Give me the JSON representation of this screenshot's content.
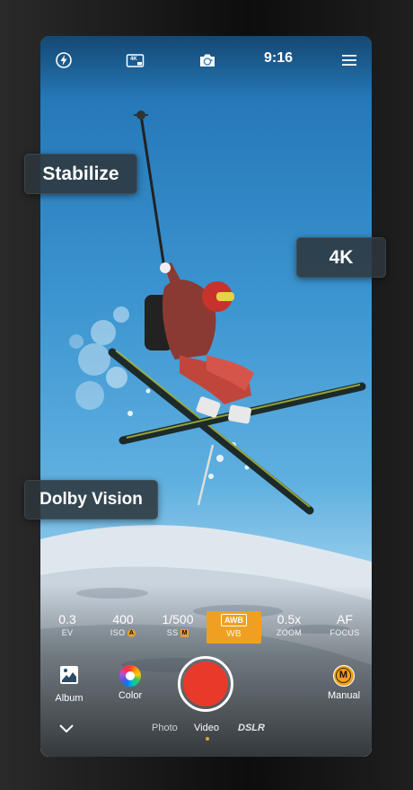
{
  "top_bar": {
    "flash_icon": "flash-auto-icon",
    "resolution_icon": "4k-icon",
    "resolution_icon_text": "4K",
    "flip_camera_icon": "camera-flip-icon",
    "time": "9:16",
    "menu_icon": "hamburger-menu-icon"
  },
  "params": [
    {
      "value": "0.3",
      "label": "EV"
    },
    {
      "value": "400",
      "label": "ISO",
      "badge": "A"
    },
    {
      "value": "1/500",
      "label": "SS",
      "badge": "M"
    },
    {
      "value": "AWB",
      "label": "WB",
      "selected": true
    },
    {
      "value": "0.5x",
      "label": "ZOOM"
    },
    {
      "value": "AF",
      "label": "FOCUS"
    }
  ],
  "controls": {
    "album_label": "Album",
    "color_label": "Color",
    "manual_label": "Manual",
    "manual_icon_text": "M"
  },
  "modes": {
    "photo": "Photo",
    "video": "Video",
    "dslr": "DSLR",
    "active": "Video"
  },
  "callouts": {
    "stabilize": "Stabilize",
    "resolution": "4K",
    "dolby": "Dolby Vision"
  },
  "colors": {
    "accent": "#f0a020",
    "record": "#e8392b"
  }
}
